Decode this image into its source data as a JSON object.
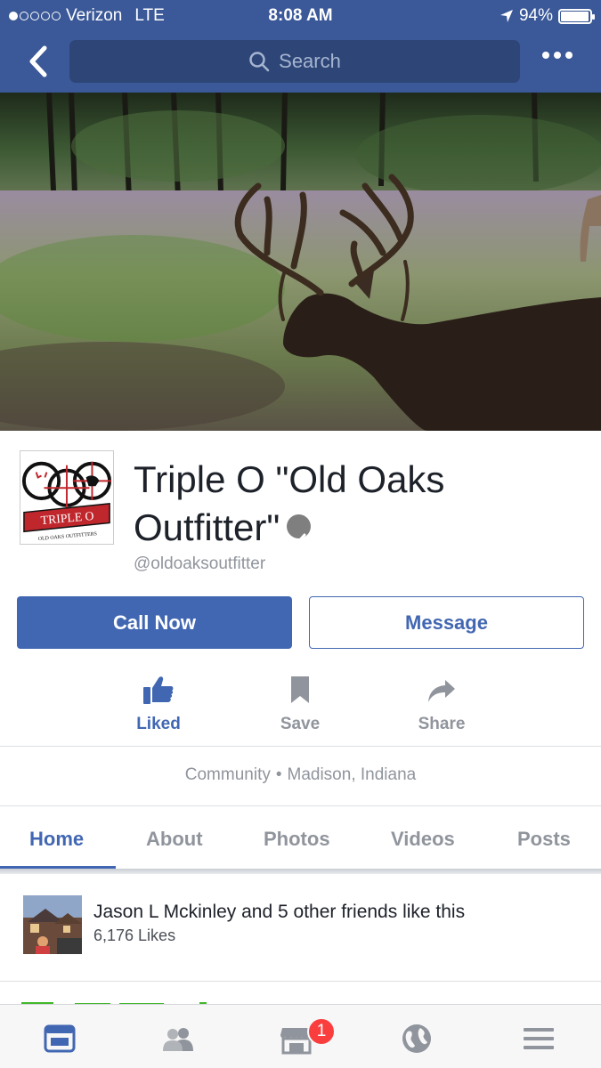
{
  "status_bar": {
    "carrier": "Verizon",
    "network": "LTE",
    "time": "8:08 AM",
    "battery": "94%",
    "battery_level": 0.94
  },
  "nav": {
    "search_placeholder": "Search"
  },
  "page": {
    "name": "Triple O \"Old Oaks Outfitter\"",
    "handle": "@oldoaksoutfitter",
    "logo_text": "TRIPLE O",
    "logo_subtext": "OLD OAKS OUTFITTERS"
  },
  "buttons": {
    "call": "Call Now",
    "message": "Message"
  },
  "actions": [
    {
      "label": "Liked",
      "icon": "thumbs-up-icon"
    },
    {
      "label": "Save",
      "icon": "bookmark-icon"
    },
    {
      "label": "Share",
      "icon": "share-arrow-icon"
    }
  ],
  "meta": {
    "category": "Community",
    "location": "Madison, Indiana"
  },
  "tabs": [
    "Home",
    "About",
    "Photos",
    "Videos",
    "Posts"
  ],
  "active_tab": "Home",
  "friends": {
    "text": "Jason L Mckinley and 5 other friends like this",
    "likes": "6,176 Likes"
  },
  "bottom_bar": {
    "items": [
      "news-feed-icon",
      "friends-icon",
      "marketplace-icon",
      "globe-icon",
      "menu-icon"
    ],
    "marketplace_badge": "1"
  },
  "colors": {
    "brand": "#3b5998",
    "accent": "#4267b2",
    "muted": "#90949c",
    "badge": "#fa3e3e"
  }
}
